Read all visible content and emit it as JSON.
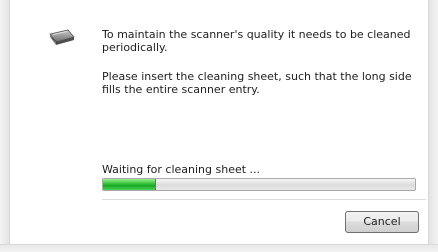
{
  "dialog": {
    "message_1": "To maintain the scanner's quality it needs to be cleaned periodically.",
    "message_2": "Please insert the cleaning sheet, such that the long side fills the entire scanner entry.",
    "status_text": "Waiting for cleaning sheet ...",
    "progress_fraction": 0.17,
    "cancel_label": "Cancel",
    "icon": "scanner-icon"
  },
  "colors": {
    "progress_green": "#2fc236",
    "button_border": "#707070",
    "text": "#1e1e1e"
  }
}
